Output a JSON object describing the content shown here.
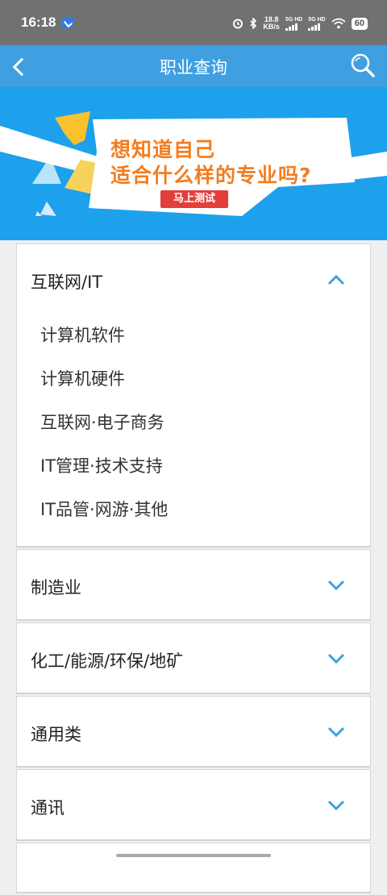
{
  "status_bar": {
    "time": "16:18",
    "speed_value": "18.8",
    "speed_unit": "KB/s",
    "sim1": "5G HD",
    "sim2": "5G HD",
    "battery": "60"
  },
  "header": {
    "title": "职业查询",
    "back_icon": "chevron-left-icon",
    "search_icon": "search-icon"
  },
  "banner": {
    "line1": "想知道自己",
    "line2": "适合什么样的专业吗?",
    "button": "马上测试"
  },
  "categories": [
    {
      "label": "互联网/IT",
      "expanded": true,
      "items": [
        "计算机软件",
        "计算机硬件",
        "互联网·电子商务",
        "IT管理·技术支持",
        "IT品管·网游·其他"
      ]
    },
    {
      "label": "制造业",
      "expanded": false
    },
    {
      "label": "化工/能源/环保/地矿",
      "expanded": false
    },
    {
      "label": "通用类",
      "expanded": false
    },
    {
      "label": "通讯",
      "expanded": false
    }
  ],
  "colors": {
    "header_bg": "#3f9fe0",
    "banner_bg": "#1da1ec",
    "chevron": "#3aa3dc",
    "banner_text": "#f47c1e",
    "banner_button": "#e23f3a"
  }
}
